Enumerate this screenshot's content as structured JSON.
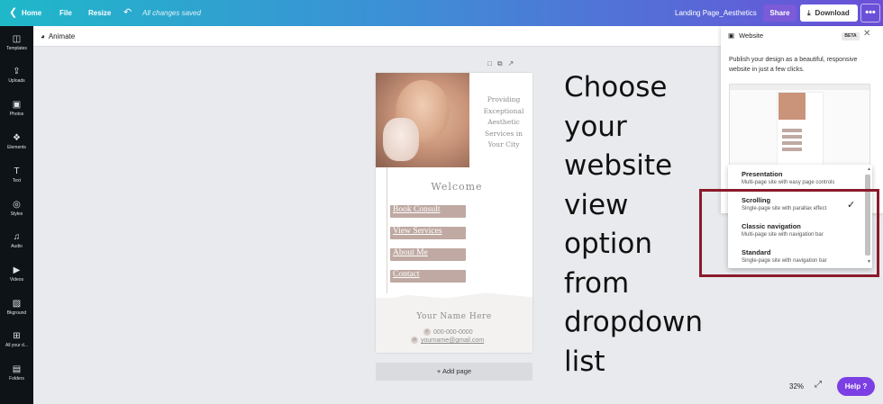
{
  "topbar": {
    "home": "Home",
    "file": "File",
    "resize": "Resize",
    "saved_status": "All changes saved",
    "doc_title": "Landing Page_Aesthetics",
    "share": "Share",
    "download": "Download",
    "more": "•••"
  },
  "sidebar": {
    "items": [
      {
        "label": "Templates",
        "icon": "◫"
      },
      {
        "label": "Uploads",
        "icon": "⇪"
      },
      {
        "label": "Photos",
        "icon": "▣"
      },
      {
        "label": "Elements",
        "icon": "❖"
      },
      {
        "label": "Text",
        "icon": "T"
      },
      {
        "label": "Styles",
        "icon": "◎"
      },
      {
        "label": "Audio",
        "icon": "♫"
      },
      {
        "label": "Videos",
        "icon": "▶"
      },
      {
        "label": "Bkground",
        "icon": "▨"
      },
      {
        "label": "All your d...",
        "icon": "⊞"
      },
      {
        "label": "Folders",
        "icon": "▤"
      }
    ]
  },
  "toolbar": {
    "animate": "Animate"
  },
  "design": {
    "tagline": "Providing Exceptional Aesthetic Services in Your City",
    "welcome": "Welcome",
    "nav": [
      "Book Consult",
      "View Services",
      "About Me",
      "Contact"
    ],
    "your_name": "Your Name Here",
    "phone": "000-000-0000",
    "email": "yourname@gmail.com"
  },
  "add_page": "+ Add page",
  "instruction": "Choose your website view option from dropdown list",
  "panel": {
    "title": "Website",
    "badge": "BETA",
    "description": "Publish your design as a beautiful, responsive website in just a few clicks."
  },
  "dropdown": {
    "options": [
      {
        "title": "Presentation",
        "desc": "Multi-page site with easy page controls"
      },
      {
        "title": "Scrolling",
        "desc": "Single-page site with parallax effect"
      },
      {
        "title": "Classic navigation",
        "desc": "Multi-page site with navigation bar"
      },
      {
        "title": "Standard",
        "desc": "Single-page site with navigation bar"
      }
    ],
    "selected": "Scrolling"
  },
  "footer": {
    "zoom": "32%",
    "help": "Help ?"
  },
  "colors": {
    "highlight": "#8b1a2b",
    "accent": "#7b3fe4"
  }
}
